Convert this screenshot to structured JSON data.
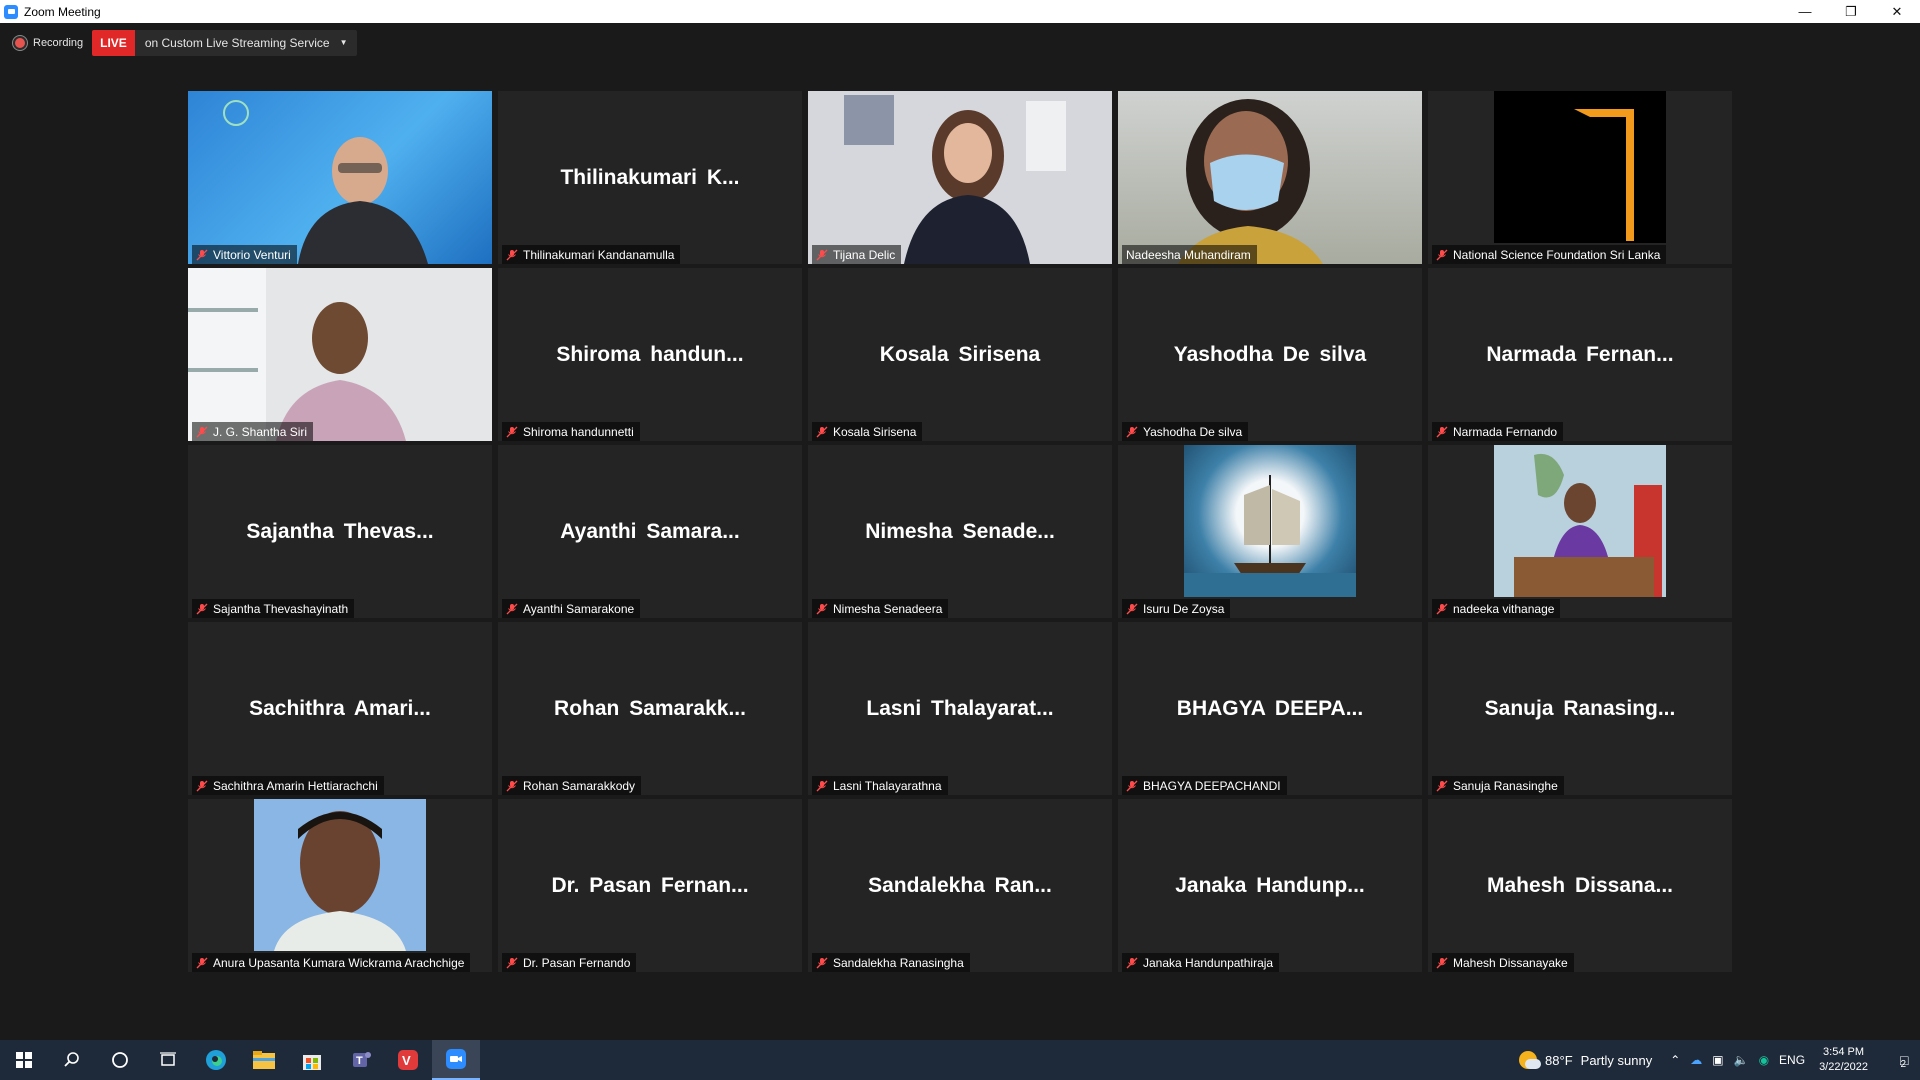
{
  "window": {
    "title": "Zoom Meeting"
  },
  "recording": {
    "label": "Recording",
    "live_badge": "LIVE",
    "live_service": "on Custom Live Streaming Service"
  },
  "participants": [
    {
      "big_name": "",
      "label": "Vittorio Venturi",
      "video": "blue-presenter",
      "active": false
    },
    {
      "big_name": "Thilinakumari  K...",
      "label": "Thilinakumari Kandanamulla",
      "video": "",
      "active": false
    },
    {
      "big_name": "",
      "label": "Tijana Delic",
      "video": "woman-office",
      "active": false
    },
    {
      "big_name": "",
      "label": "Nadeesha Muhandiram",
      "video": "masked-woman",
      "active": true
    },
    {
      "big_name": "",
      "label": "National Science Foundation Sri Lanka",
      "video": "black-logo",
      "active": false
    },
    {
      "big_name": "",
      "label": "J. G. Shantha Siri",
      "video": "man-office",
      "active": false
    },
    {
      "big_name": "Shiroma  handun...",
      "label": "Shiroma handunnetti",
      "video": "",
      "active": false
    },
    {
      "big_name": "Kosala Sirisena",
      "label": "Kosala Sirisena",
      "video": "",
      "active": false
    },
    {
      "big_name": "Yashodha De silva",
      "label": "Yashodha De silva",
      "video": "",
      "active": false
    },
    {
      "big_name": "Narmada  Fernan...",
      "label": "Narmada Fernando",
      "video": "",
      "active": false
    },
    {
      "big_name": "Sajantha  Thevas...",
      "label": "Sajantha Thevashayinath",
      "video": "",
      "active": false
    },
    {
      "big_name": "Ayanthi  Samara...",
      "label": "Ayanthi Samarakone",
      "video": "",
      "active": false
    },
    {
      "big_name": "Nimesha  Senade...",
      "label": "Nimesha Senadeera",
      "video": "",
      "active": false
    },
    {
      "big_name": "",
      "label": "Isuru De Zoysa",
      "video": "ship-photo",
      "active": false
    },
    {
      "big_name": "",
      "label": "nadeeka vithanage",
      "video": "woman-desk",
      "active": false
    },
    {
      "big_name": "Sachithra  Amari...",
      "label": "Sachithra Amarin Hettiarachchi",
      "video": "",
      "active": false
    },
    {
      "big_name": "Rohan  Samarakk...",
      "label": "Rohan Samarakkody",
      "video": "",
      "active": false
    },
    {
      "big_name": "Lasni  Thalayarat...",
      "label": "Lasni Thalayarathna",
      "video": "",
      "active": false
    },
    {
      "big_name": "BHAGYA  DEEPA...",
      "label": "BHAGYA DEEPACHANDI",
      "video": "",
      "active": false
    },
    {
      "big_name": "Sanuja  Ranasing...",
      "label": "Sanuja Ranasinghe",
      "video": "",
      "active": false
    },
    {
      "big_name": "",
      "label": "Anura Upasanta Kumara Wickrama Arachchige",
      "video": "portrait-man",
      "active": false
    },
    {
      "big_name": "Dr. Pasan  Fernan...",
      "label": "Dr. Pasan Fernando",
      "video": "",
      "active": false
    },
    {
      "big_name": "Sandalekha  Ran...",
      "label": "Sandalekha Ranasingha",
      "video": "",
      "active": false
    },
    {
      "big_name": "Janaka  Handunp...",
      "label": "Janaka Handunpathiraja",
      "video": "",
      "active": false
    },
    {
      "big_name": "Mahesh  Dissana...",
      "label": "Mahesh Dissanayake",
      "video": "",
      "active": false
    }
  ],
  "taskbar": {
    "weather_temp": "88°F",
    "weather_text": "Partly sunny",
    "lang": "ENG",
    "time": "3:54 PM",
    "date": "3/22/2022",
    "notification_count": "2"
  }
}
